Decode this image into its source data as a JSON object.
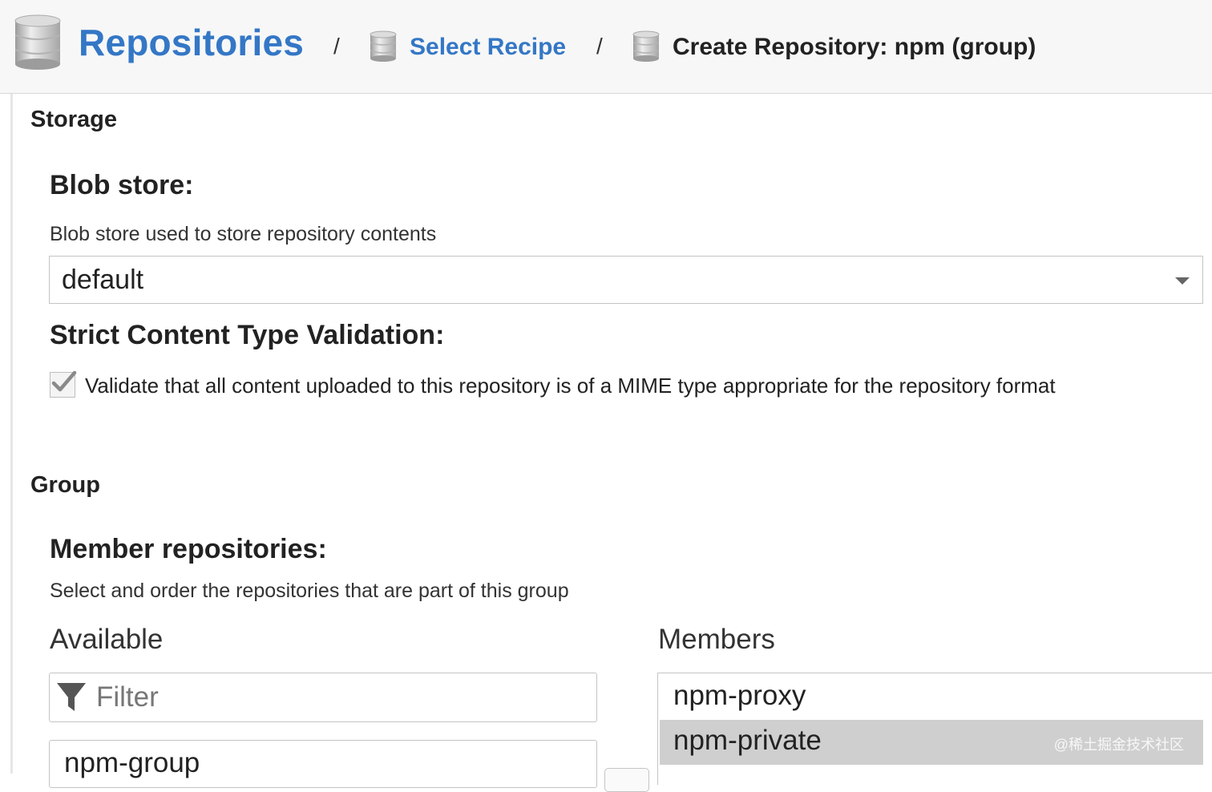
{
  "breadcrumb": {
    "root": "Repositories",
    "separator": "/",
    "recipe": "Select Recipe",
    "current": "Create Repository: npm (group)"
  },
  "storage": {
    "section_title": "Storage",
    "blob_store": {
      "label": "Blob store:",
      "help": "Blob store used to store repository contents",
      "value": "default"
    },
    "strict_validation": {
      "label": "Strict Content Type Validation:",
      "checked": true,
      "checkbox_label": "Validate that all content uploaded to this repository is of a MIME type appropriate for the repository format"
    }
  },
  "group": {
    "section_title": "Group",
    "members_field": {
      "label": "Member repositories:",
      "help": "Select and order the repositories that are part of this group"
    },
    "available": {
      "title": "Available",
      "filter_placeholder": "Filter",
      "items": [
        "npm-group"
      ]
    },
    "members": {
      "title": "Members",
      "items": [
        "npm-proxy",
        "npm-private"
      ],
      "selected": "npm-private"
    }
  },
  "watermark": "@稀土掘金技术社区",
  "colors": {
    "link": "#3477c6",
    "header_bg": "#f7f7f7",
    "selected_row": "#cfcfcf"
  },
  "icons": {
    "breadcrumb": "database-icon",
    "filter": "filter-icon",
    "checkbox": "checkmark-icon",
    "dropdown": "caret-down-icon"
  }
}
